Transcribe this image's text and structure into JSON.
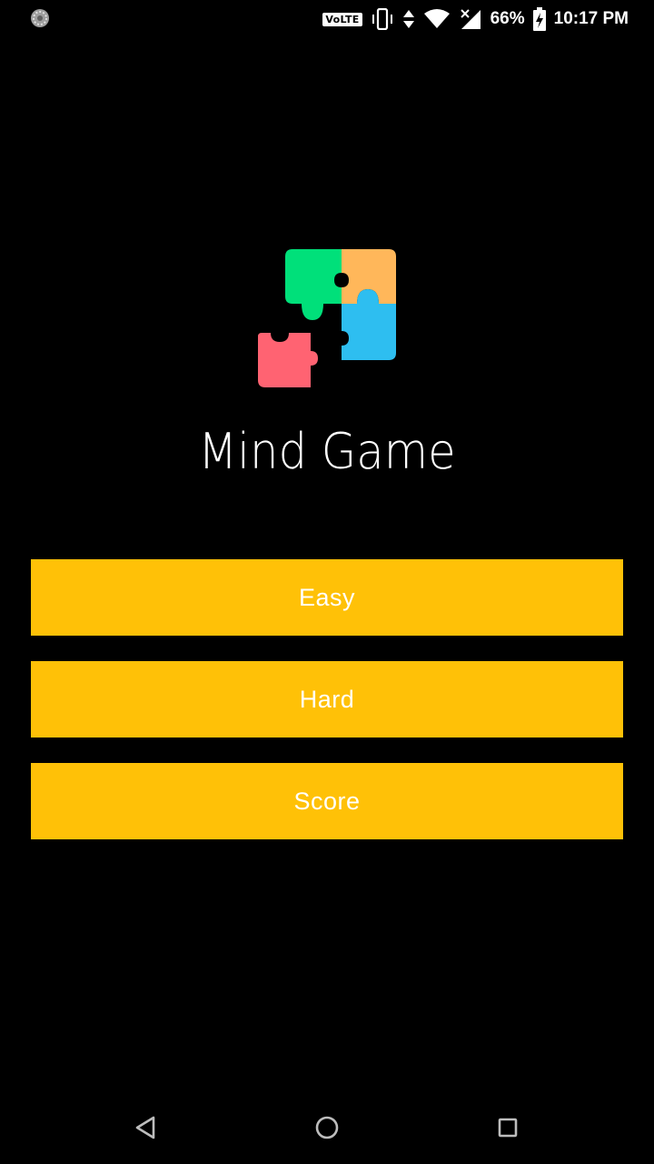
{
  "status_bar": {
    "volte_label": "VoLTE",
    "battery_percent": "66%",
    "time": "10:17 PM",
    "icons": [
      "loading-icon",
      "vibrate-icon",
      "data-arrows-icon",
      "wifi-icon",
      "signal-icon",
      "battery-charging-icon"
    ]
  },
  "app": {
    "title": "Mind Game",
    "logo_icon": "puzzle-icon",
    "colors": {
      "green": "#00e07a",
      "orange": "#ffb75a",
      "blue": "#2ebef0",
      "red": "#ff6372"
    }
  },
  "menu": {
    "easy_label": "Easy",
    "hard_label": "Hard",
    "score_label": "Score",
    "button_color": "#ffc107"
  },
  "nav_bar": {
    "icons": [
      "back-icon",
      "home-icon",
      "recent-apps-icon"
    ]
  }
}
